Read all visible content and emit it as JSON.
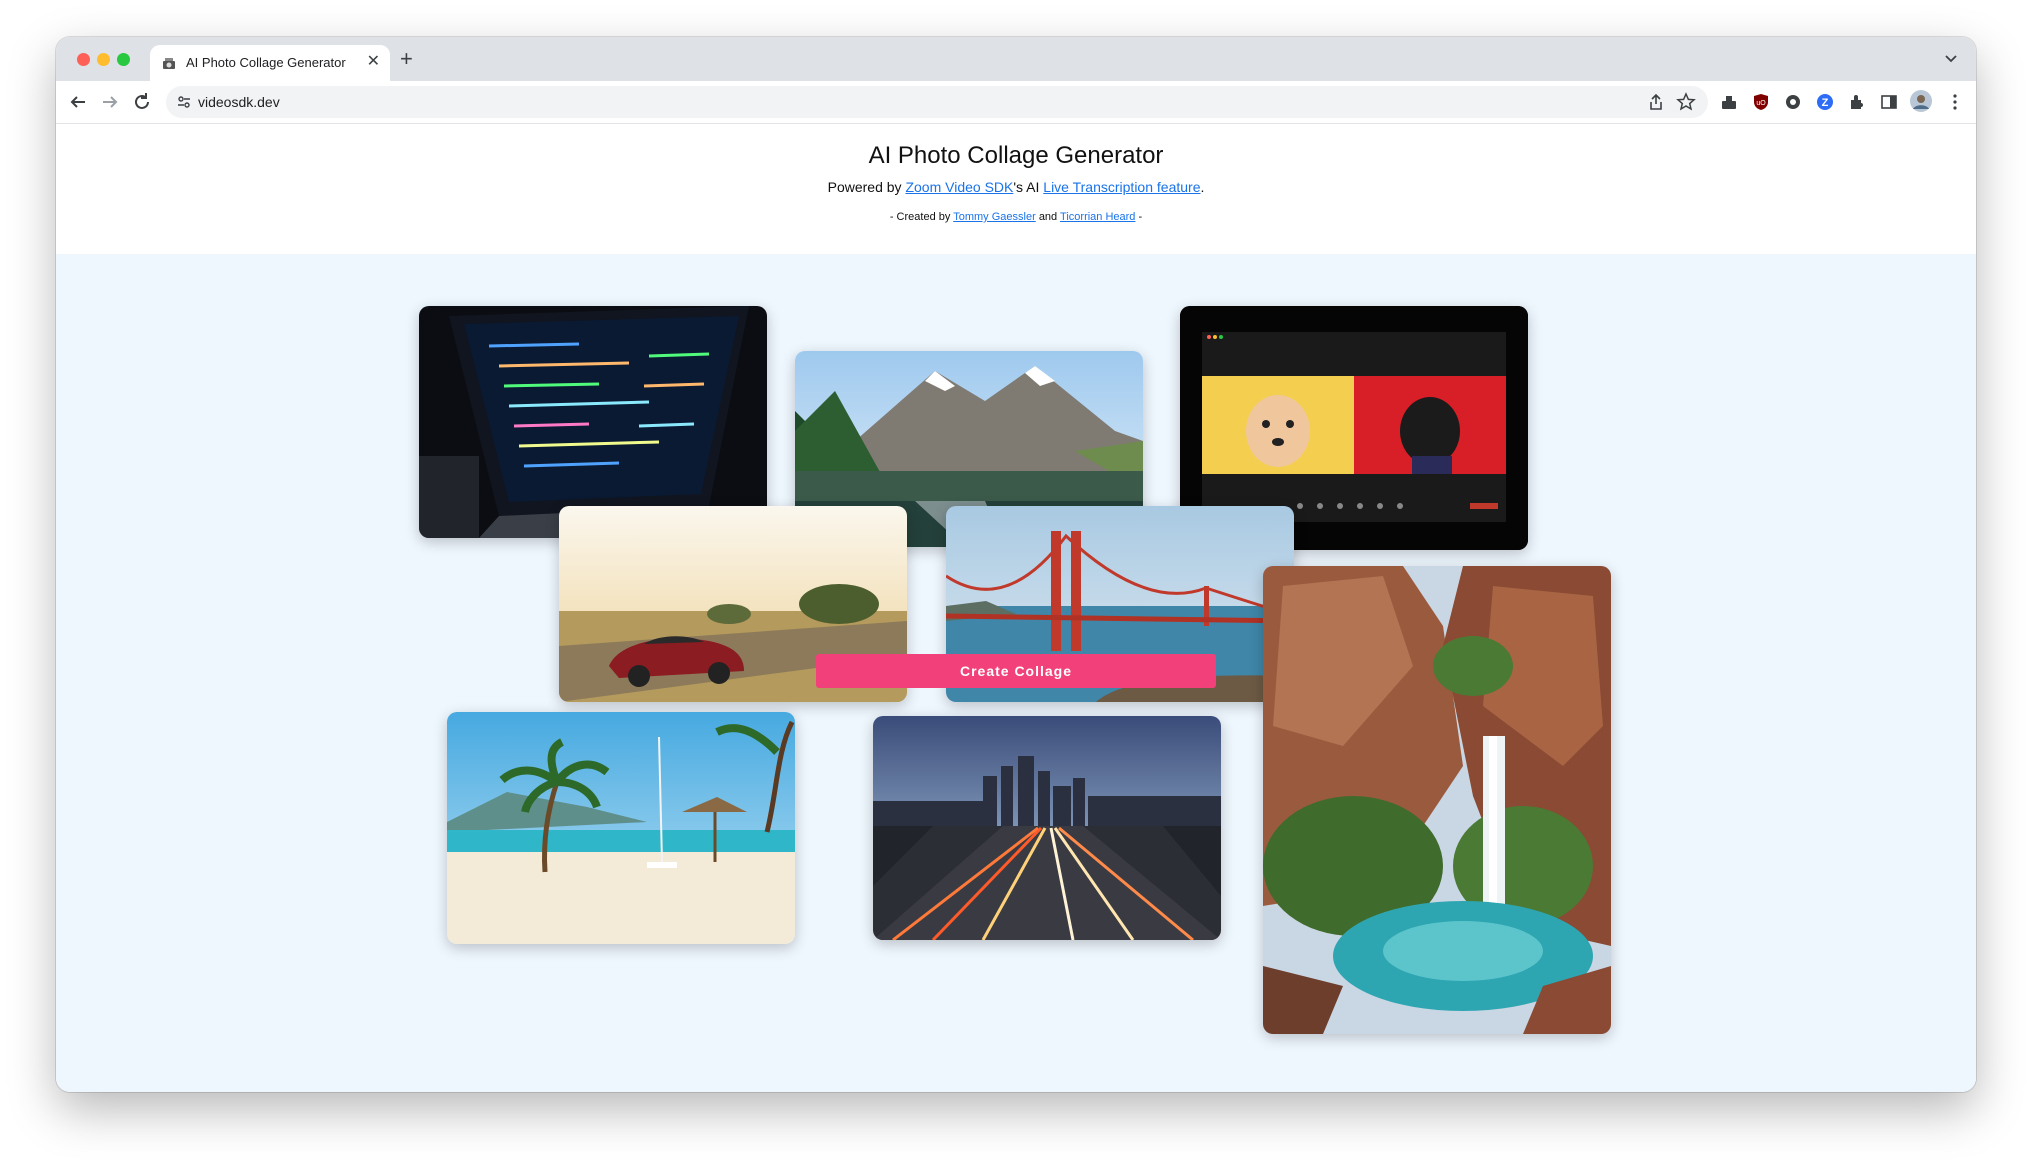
{
  "browser": {
    "tab_title": "AI Photo Collage Generator",
    "tab_close_glyph": "✕",
    "new_tab_glyph": "+",
    "url": "videosdk.dev"
  },
  "header": {
    "title": "AI Photo Collage Generator",
    "powered_by": "Powered by",
    "zoom_link": "Zoom Video SDK",
    "s_ai": "'s AI",
    "transcription_link": "Live Transcription feature",
    "period": ".",
    "created_prefix": "- Created by",
    "author1": "Tommy Gaessler",
    "and": "and",
    "author2": "Ticorrian Heard",
    "created_suffix": "-"
  },
  "collage": {
    "create_button": "Create Collage",
    "photos": [
      "laptop-code",
      "mountain-lake",
      "video-call",
      "tesla-car",
      "golden-gate",
      "waterfall-canyon",
      "beach-palms",
      "city-highway"
    ]
  },
  "colors": {
    "accent": "#f2407a",
    "link": "#1a73e8",
    "collage_bg": "#eef6fe"
  }
}
